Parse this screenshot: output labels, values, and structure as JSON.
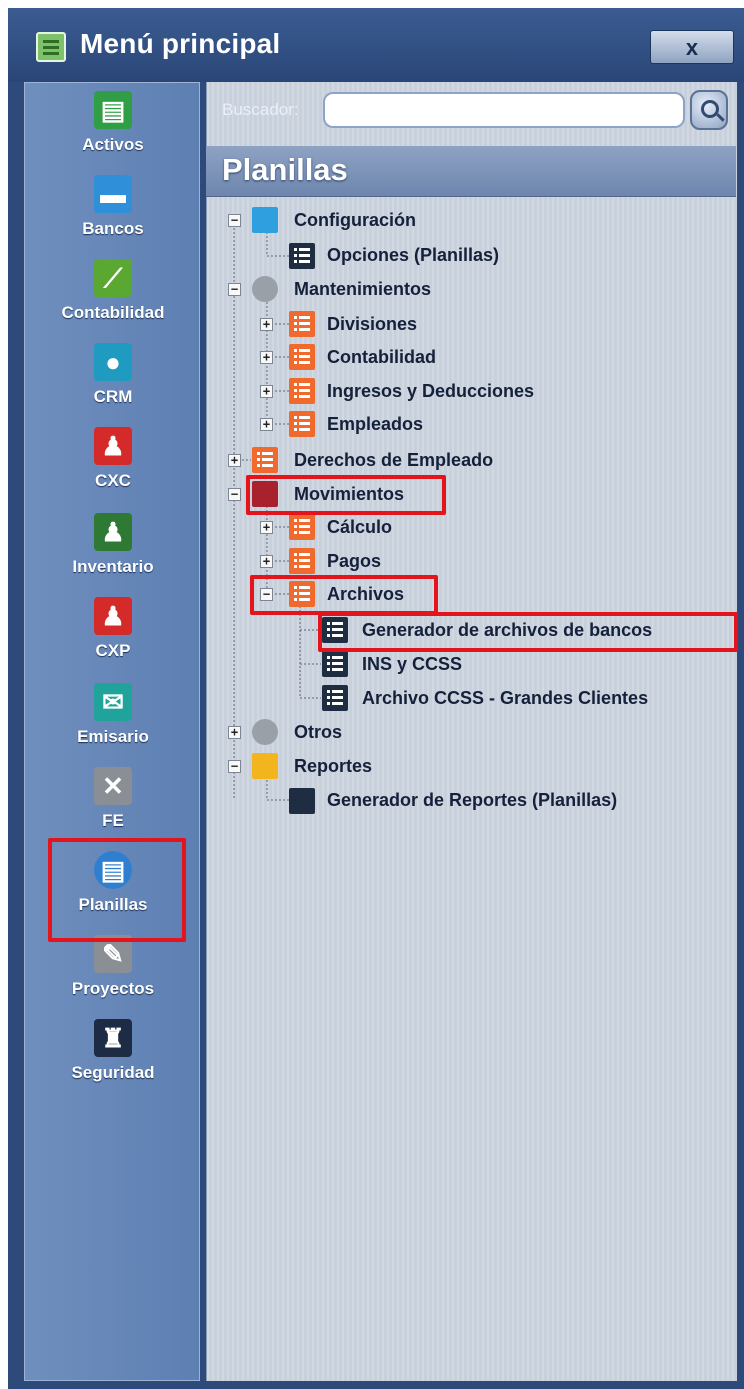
{
  "window": {
    "title": "Menú principal",
    "close_label": "x"
  },
  "sidebar": {
    "items": [
      {
        "label": "Activos",
        "icon": "cash-register-icon",
        "color": "#2f9e44"
      },
      {
        "label": "Bancos",
        "icon": "briefcase-icon",
        "color": "#2f8fd8"
      },
      {
        "label": "Contabilidad",
        "icon": "line-chart-icon",
        "color": "#5aa832"
      },
      {
        "label": "CRM",
        "icon": "globe-icon",
        "color": "#1f9bc1"
      },
      {
        "label": "CXC",
        "icon": "person-pushing-icon",
        "color": "#d42a2a"
      },
      {
        "label": "Inventario",
        "icon": "person-desk-icon",
        "color": "#2e7a34"
      },
      {
        "label": "CXP",
        "icon": "person-money-icon",
        "color": "#d42a2a"
      },
      {
        "label": "Emisario",
        "icon": "envelope-icon",
        "color": "#1fa39a"
      },
      {
        "label": "FE",
        "icon": "tools-icon",
        "color": "#8a8f96"
      },
      {
        "label": "Planillas",
        "icon": "payroll-icon",
        "color": "#2f7fd0",
        "selected": true
      },
      {
        "label": "Proyectos",
        "icon": "pencil-ruler-icon",
        "color": "#8a8f96"
      },
      {
        "label": "Seguridad",
        "icon": "castle-icon",
        "color": "#1e2b44"
      }
    ]
  },
  "search": {
    "label": "Buscador:",
    "value": "",
    "placeholder": ""
  },
  "section": {
    "title": "Planillas"
  },
  "tree": {
    "configuracion": "Configuración",
    "opciones": "Opciones (Planillas)",
    "mantenimientos": "Mantenimientos",
    "divisiones": "Divisiones",
    "contabilidad": "Contabilidad",
    "ingresos": "Ingresos y Deducciones",
    "empleados": "Empleados",
    "derechos": "Derechos de Empleado",
    "movimientos": "Movimientos",
    "calculo": "Cálculo",
    "pagos": "Pagos",
    "archivos": "Archivos",
    "generador_bancos": "Generador de archivos de bancos",
    "ins_ccss": "INS y CCSS",
    "archivo_ccss": "Archivo CCSS - Grandes Clientes",
    "otros": "Otros",
    "reportes": "Reportes",
    "generador_reportes": "Generador de Reportes (Planillas)"
  },
  "colors": {
    "highlight": "#e3141b",
    "window_bg": "#2d4a7a"
  }
}
